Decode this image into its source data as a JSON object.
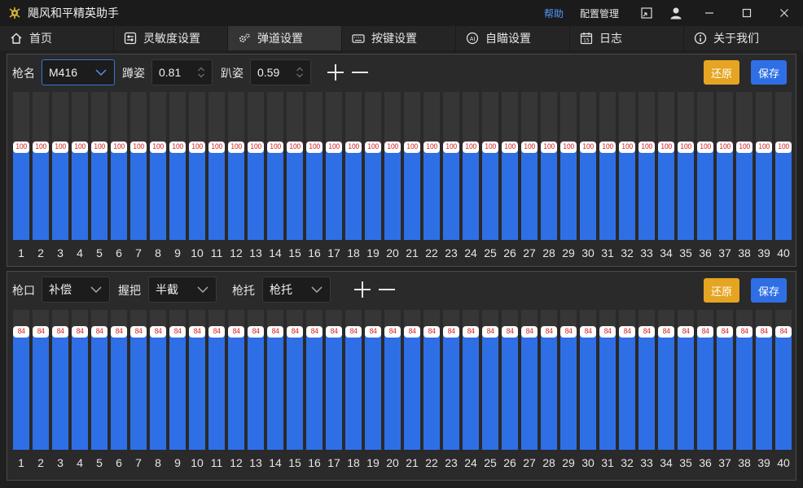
{
  "app": {
    "title": "飓风和平精英助手",
    "help_label": "帮助",
    "config_label": "配置管理"
  },
  "tabs": [
    {
      "label": "首页",
      "icon": "home-icon"
    },
    {
      "label": "灵敏度设置",
      "icon": "sliders-icon"
    },
    {
      "label": "弹道设置",
      "icon": "gears-icon",
      "active": true
    },
    {
      "label": "按键设置",
      "icon": "keyboard-icon"
    },
    {
      "label": "自瞄设置",
      "icon": "ai-aim-icon"
    },
    {
      "label": "日志",
      "icon": "calendar-icon"
    },
    {
      "label": "关于我们",
      "icon": "info-icon"
    }
  ],
  "panel1": {
    "gun_label": "枪名",
    "gun_value": "M416",
    "crouch_label": "蹲姿",
    "crouch_value": "0.81",
    "prone_label": "趴姿",
    "prone_value": "0.59",
    "restore_label": "还原",
    "save_label": "保存",
    "bar_values": [
      100,
      100,
      100,
      100,
      100,
      100,
      100,
      100,
      100,
      100,
      100,
      100,
      100,
      100,
      100,
      100,
      100,
      100,
      100,
      100,
      100,
      100,
      100,
      100,
      100,
      100,
      100,
      100,
      100,
      100,
      100,
      100,
      100,
      100,
      100,
      100,
      100,
      100,
      100,
      100
    ],
    "fill_fraction": 0.62
  },
  "panel2": {
    "muzzle_label": "枪口",
    "muzzle_value": "补偿",
    "grip_label": "握把",
    "grip_value": "半截",
    "stock_label": "枪托",
    "stock_value": "枪托",
    "restore_label": "还原",
    "save_label": "保存",
    "bar_values": [
      84,
      84,
      84,
      84,
      84,
      84,
      84,
      84,
      84,
      84,
      84,
      84,
      84,
      84,
      84,
      84,
      84,
      84,
      84,
      84,
      84,
      84,
      84,
      84,
      84,
      84,
      84,
      84,
      84,
      84,
      84,
      84,
      84,
      84,
      84,
      84,
      84,
      84,
      84,
      84
    ],
    "fill_fraction": 0.84
  },
  "bar_indices": [
    "1",
    "2",
    "3",
    "4",
    "5",
    "6",
    "7",
    "8",
    "9",
    "10",
    "11",
    "12",
    "13",
    "14",
    "15",
    "16",
    "17",
    "18",
    "19",
    "20",
    "21",
    "22",
    "23",
    "24",
    "25",
    "26",
    "27",
    "28",
    "29",
    "30",
    "31",
    "32",
    "33",
    "34",
    "35",
    "36",
    "37",
    "38",
    "39",
    "40"
  ],
  "colors": {
    "accent_blue": "#2f6fe6",
    "restore_orange": "#e5a422",
    "badge_text_red": "#d42a2a",
    "link_blue": "#4e9bff"
  }
}
